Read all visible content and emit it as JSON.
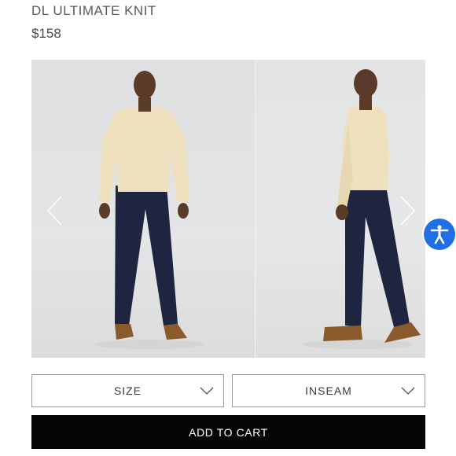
{
  "product": {
    "title": "DL ULTIMATE KNIT",
    "price": "$158"
  },
  "gallery": {
    "prev_icon": "chevron-left-icon",
    "next_icon": "chevron-right-icon"
  },
  "selectors": {
    "size_label": "SIZE",
    "inseam_label": "INSEAM"
  },
  "cart": {
    "add_label": "ADD TO CART"
  },
  "accessibility": {
    "icon": "accessibility-person-icon",
    "color": "#1f6fe5"
  }
}
